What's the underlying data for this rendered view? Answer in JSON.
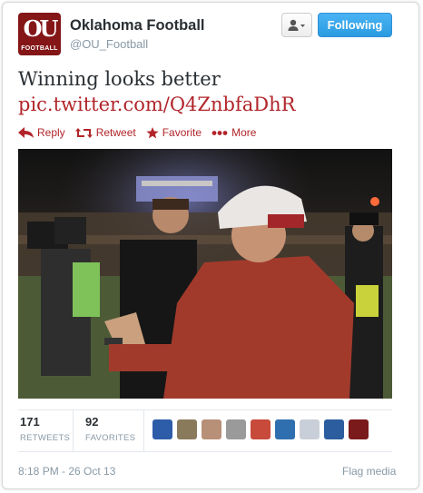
{
  "header": {
    "display_name": "Oklahoma Football",
    "handle": "@OU_Football",
    "avatar_text": "OU",
    "avatar_subtext": "FOOTBALL",
    "follow_label": "Following",
    "user_menu_icon": "person-dropdown-icon"
  },
  "tweet": {
    "text": "Winning looks better",
    "link": "pic.twitter.com/Q4ZnbfaDhR"
  },
  "actions": [
    {
      "label": "Reply",
      "icon": "reply-arrow-icon"
    },
    {
      "label": "Retweet",
      "icon": "retweet-icon"
    },
    {
      "label": "Favorite",
      "icon": "star-icon"
    },
    {
      "label": "More",
      "icon": "more-dots-icon"
    }
  ],
  "photo": {
    "icon": "photo-football-coaches-handshake"
  },
  "stats": {
    "retweets_count": "171",
    "retweets_label": "RETWEETS",
    "favorites_count": "92",
    "favorites_label": "FAVORITES"
  },
  "favoriters": [
    {
      "color": "#2d5da8"
    },
    {
      "color": "#8a7a5c"
    },
    {
      "color": "#b89078"
    },
    {
      "color": "#9a9a9a"
    },
    {
      "color": "#c74a3a"
    },
    {
      "color": "#2f6fb0"
    },
    {
      "color": "#c9cfd8"
    },
    {
      "color": "#2c5d9e"
    },
    {
      "color": "#7a1a1a"
    }
  ],
  "footer": {
    "timestamp": "8:18 PM - 26 Oct 13",
    "flag_label": "Flag media"
  },
  "colors": {
    "brand_crimson": "#841617",
    "link_red": "#b1252a",
    "follow_blue": "#2a9be0",
    "muted_gray": "#8899a6"
  }
}
